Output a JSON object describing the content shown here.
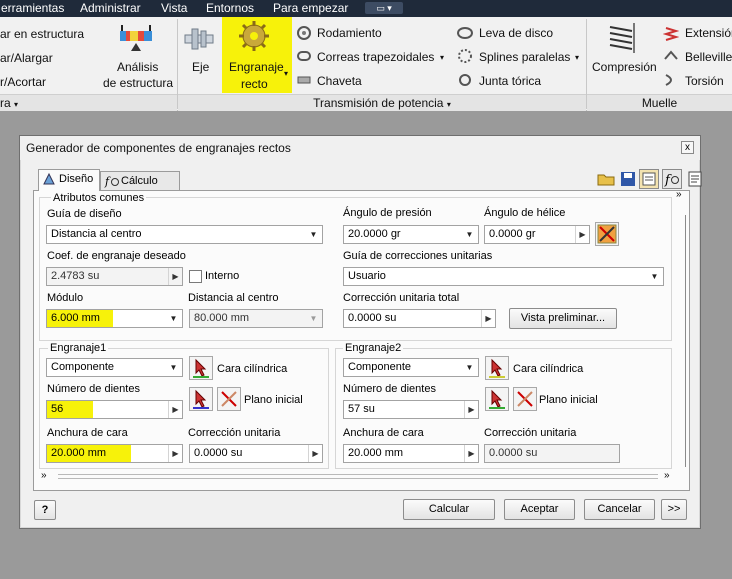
{
  "menubar": {
    "items": [
      "erramientas",
      "Administrar",
      "Vista",
      "Entornos",
      "Para empezar"
    ]
  },
  "ribbon": {
    "struct": {
      "row1": "ar en estructura",
      "row2": "ar/Alargar",
      "row3": "r/Acortar",
      "panel": "ra"
    },
    "analysis": {
      "label1": "Análisis",
      "label2": "de estructura"
    },
    "power": {
      "eje": "Eje",
      "gear1": "Engranaje",
      "gear2": "recto",
      "items": [
        "Rodamiento",
        "Correas trapezoidales",
        "Chaveta",
        "Leva de disco",
        "Splines paralelas",
        "Junta tórica"
      ],
      "panel": "Transmisión de potencia"
    },
    "spring": {
      "compresion": "Compresión",
      "items": [
        "Extensión",
        "Belleville",
        "Torsión"
      ],
      "panel": "Muelle"
    }
  },
  "dialog": {
    "title": "Generador de componentes de engranajes rectos",
    "close": "x",
    "tabs": [
      "Diseño",
      "Cálculo"
    ],
    "common": {
      "legend": "Atributos comunes",
      "guide_label": "Guía de diseño",
      "guide_value": "Distancia al centro",
      "coef_label": "Coef. de engranaje deseado",
      "coef_value": "2.4783 su",
      "interno_label": "Interno",
      "modulo_label": "Módulo",
      "modulo_value": "6.000 mm",
      "dist_label": "Distancia al centro",
      "dist_value": "80.000 mm",
      "pressure_label": "Ángulo de presión",
      "pressure_value": "20.0000 gr",
      "helix_label": "Ángulo de hélice",
      "helix_value": "0.0000 gr",
      "corr_guide_label": "Guía de correcciones unitarias",
      "corr_guide_value": "Usuario",
      "corr_total_label": "Corrección unitaria total",
      "corr_total_value": "0.0000 su",
      "preview_button": "Vista preliminar..."
    },
    "gear1": {
      "legend": "Engranaje1",
      "type_value": "Componente",
      "cyl_face": "Cara cilíndrica",
      "teeth_label": "Número de dientes",
      "teeth_value": "56",
      "start_plane": "Plano inicial",
      "width_label": "Anchura de cara",
      "width_value": "20.000 mm",
      "corr_label": "Corrección unitaria",
      "corr_value": "0.0000 su"
    },
    "gear2": {
      "legend": "Engranaje2",
      "type_value": "Componente",
      "cyl_face": "Cara cilíndrica",
      "teeth_label": "Número de dientes",
      "teeth_value": "57 su",
      "start_plane": "Plano inicial",
      "width_label": "Anchura de cara",
      "width_value": "20.000 mm",
      "corr_label": "Corrección unitaria",
      "corr_value": "0.0000 su"
    },
    "footer": {
      "help": "?",
      "calcular": "Calcular",
      "aceptar": "Aceptar",
      "cancelar": "Cancelar",
      "more": ">>"
    }
  },
  "colors": {
    "highlight": "#f7f20a",
    "menubar_bg": "#1f2a3a",
    "ribbon_bg": "#f1f1f1",
    "dialog_bg": "#f0f0f0",
    "desktop_bg": "#9a9a9a"
  }
}
